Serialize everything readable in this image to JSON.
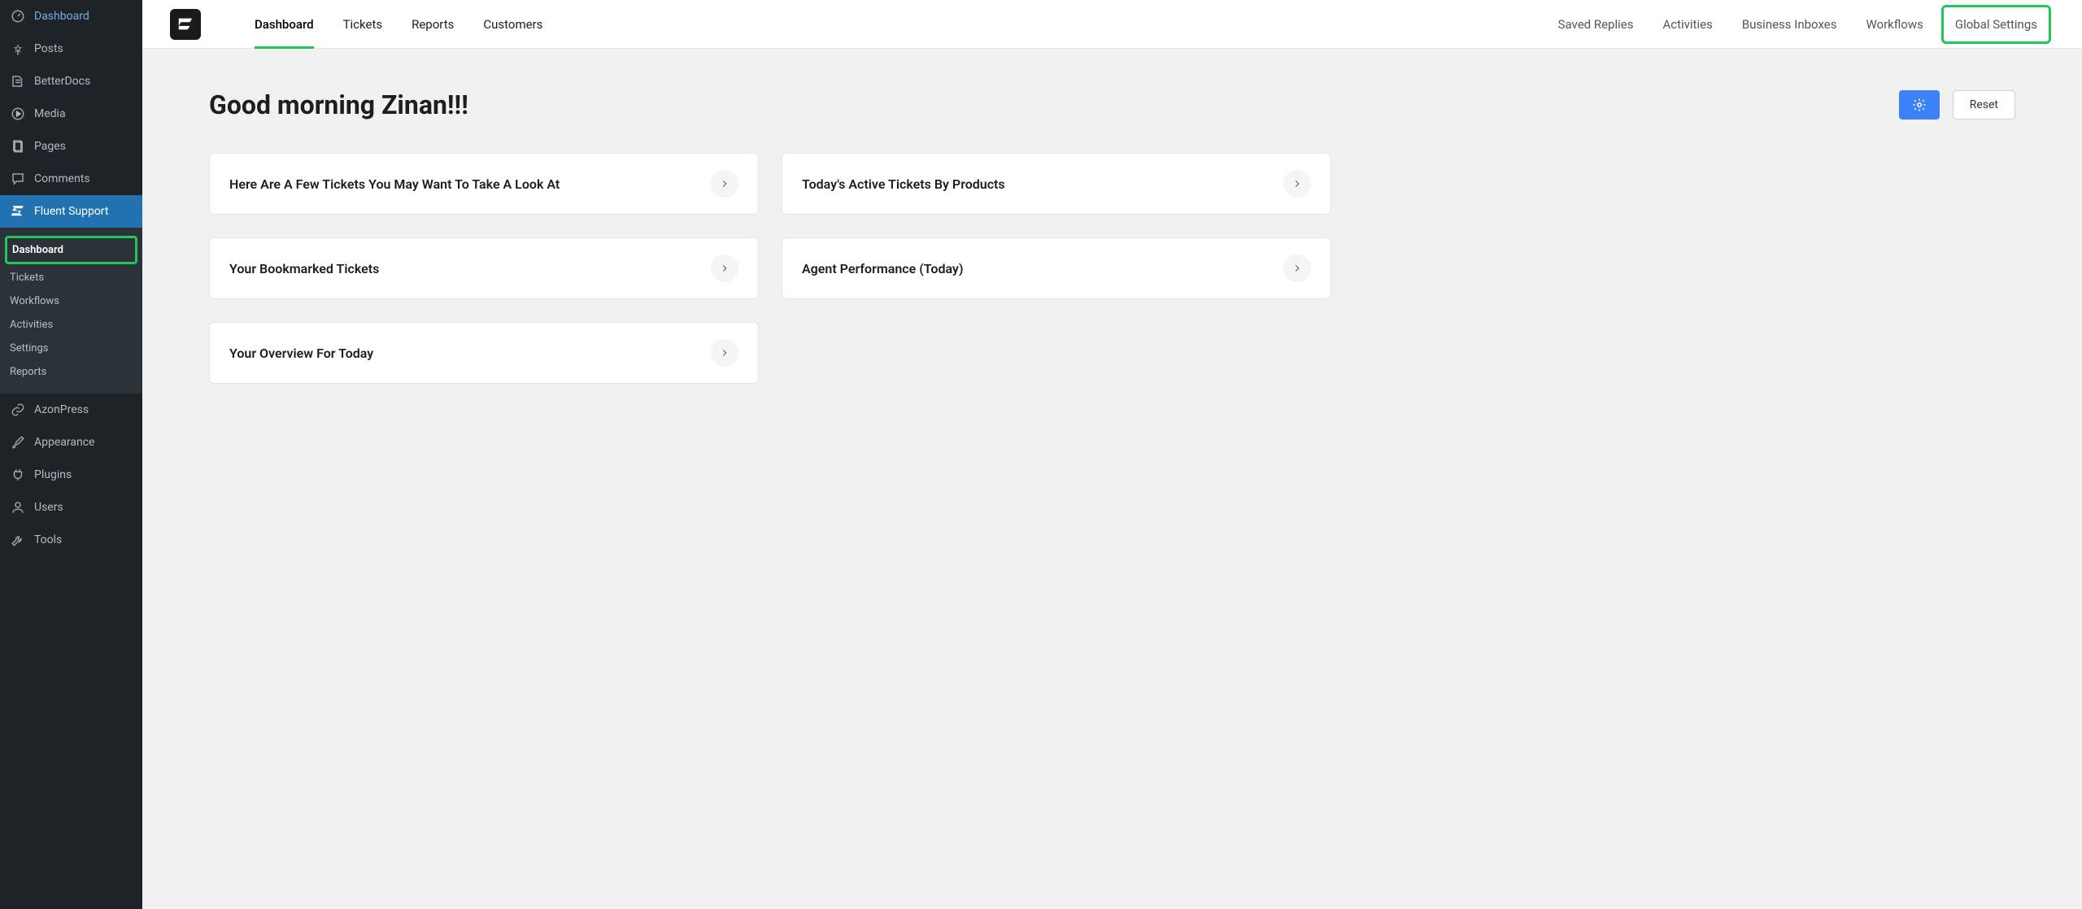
{
  "sidebar": {
    "items": [
      {
        "label": "Dashboard",
        "icon": "gauge"
      },
      {
        "label": "Posts",
        "icon": "pin"
      },
      {
        "label": "BetterDocs",
        "icon": "docs"
      },
      {
        "label": "Media",
        "icon": "media"
      },
      {
        "label": "Pages",
        "icon": "page"
      },
      {
        "label": "Comments",
        "icon": "comment"
      },
      {
        "label": "Fluent Support",
        "icon": "support",
        "active": true
      },
      {
        "label": "AzonPress",
        "icon": "link"
      },
      {
        "label": "Appearance",
        "icon": "brush"
      },
      {
        "label": "Plugins",
        "icon": "plug"
      },
      {
        "label": "Users",
        "icon": "user"
      },
      {
        "label": "Tools",
        "icon": "wrench"
      }
    ],
    "submenu": {
      "items": [
        {
          "label": "Dashboard",
          "highlighted": true
        },
        {
          "label": "Tickets"
        },
        {
          "label": "Workflows"
        },
        {
          "label": "Activities"
        },
        {
          "label": "Settings"
        },
        {
          "label": "Reports"
        }
      ]
    }
  },
  "topbar": {
    "nav_left": [
      {
        "label": "Dashboard",
        "active": true
      },
      {
        "label": "Tickets"
      },
      {
        "label": "Reports"
      },
      {
        "label": "Customers"
      }
    ],
    "nav_right": [
      {
        "label": "Saved Replies"
      },
      {
        "label": "Activities"
      },
      {
        "label": "Business Inboxes"
      },
      {
        "label": "Workflows"
      },
      {
        "label": "Global Settings",
        "highlighted": true
      }
    ]
  },
  "content": {
    "heading": "Good morning Zinan!!!",
    "reset_label": "Reset",
    "cards": [
      {
        "title": "Here Are A Few Tickets You May Want To Take A Look At"
      },
      {
        "title": "Today's Active Tickets By Products"
      },
      {
        "title": "Your Bookmarked Tickets"
      },
      {
        "title": "Agent Performance (Today)"
      },
      {
        "title": "Your Overview For Today"
      }
    ]
  }
}
